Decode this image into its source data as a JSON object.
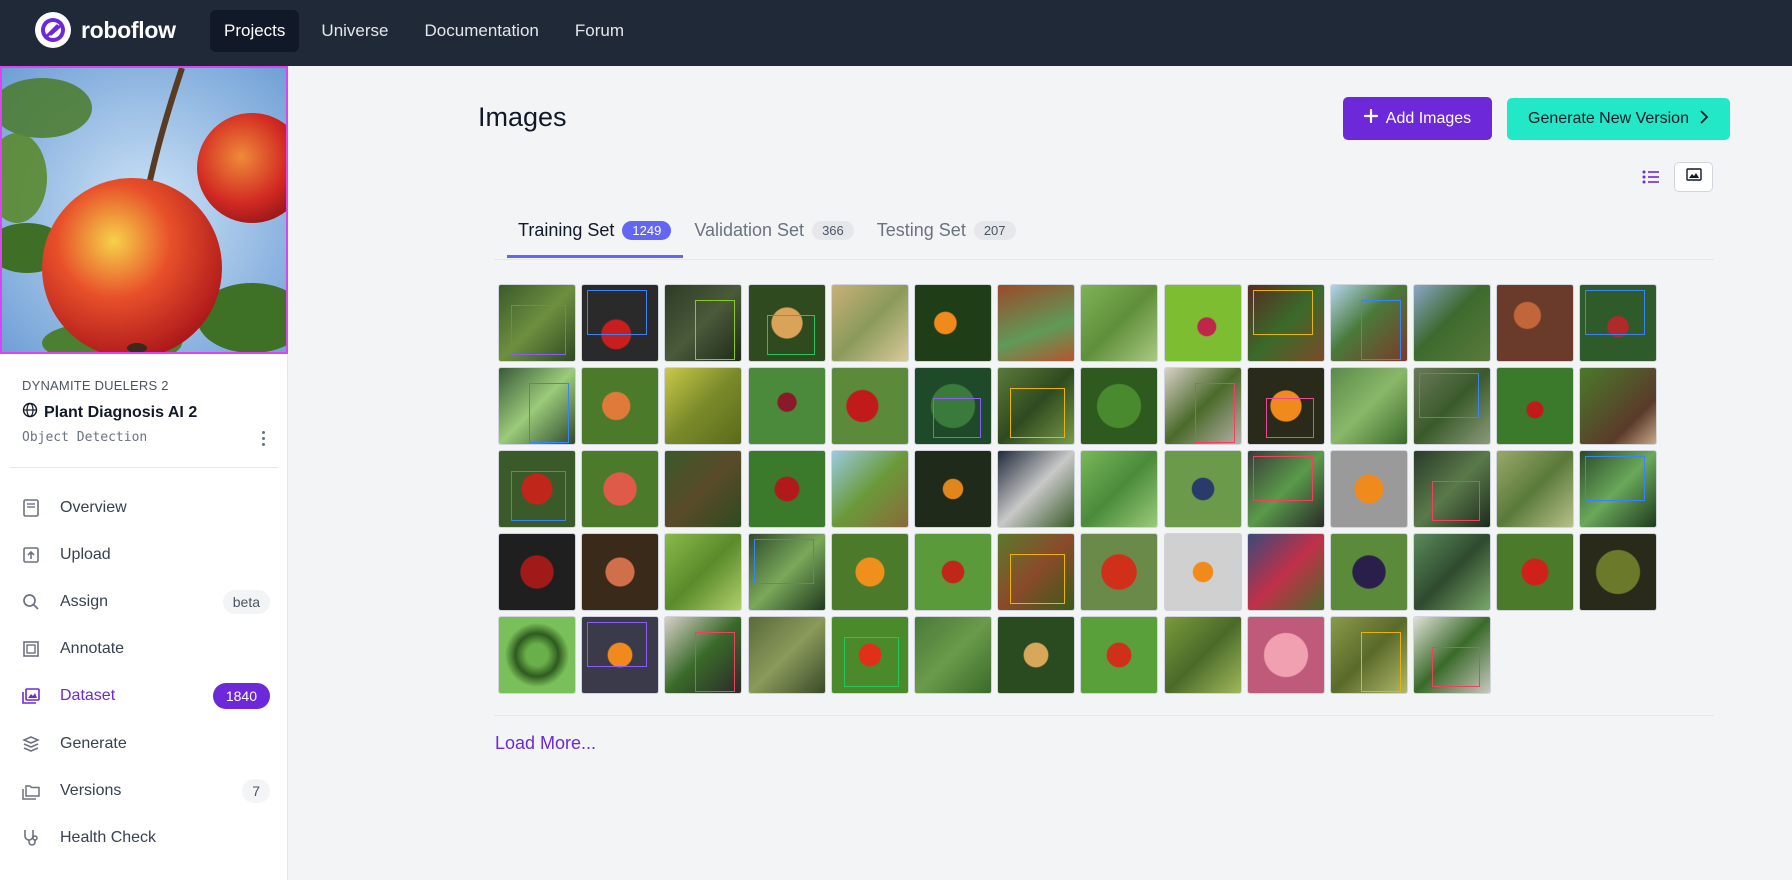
{
  "nav": {
    "brand": "roboflow",
    "links": [
      {
        "label": "Projects",
        "active": true
      },
      {
        "label": "Universe",
        "active": false
      },
      {
        "label": "Documentation",
        "active": false
      },
      {
        "label": "Forum",
        "active": false
      }
    ]
  },
  "sidebar": {
    "workspace": "DYNAMITE DUELERS 2",
    "project_name": "Plant Diagnosis AI 2",
    "project_type": "Object Detection",
    "items": [
      {
        "label": "Overview",
        "icon": "book-icon",
        "badge": ""
      },
      {
        "label": "Upload",
        "icon": "upload-icon",
        "badge": ""
      },
      {
        "label": "Assign",
        "icon": "search-icon",
        "badge": "beta"
      },
      {
        "label": "Annotate",
        "icon": "annotate-icon",
        "badge": ""
      },
      {
        "label": "Dataset",
        "icon": "images-icon",
        "badge": "1840",
        "active": true
      },
      {
        "label": "Generate",
        "icon": "generate-icon",
        "badge": ""
      },
      {
        "label": "Versions",
        "icon": "folders-icon",
        "badge": "7"
      },
      {
        "label": "Health Check",
        "icon": "stethoscope-icon",
        "badge": ""
      }
    ]
  },
  "main": {
    "title": "Images",
    "add_images_label": "Add Images",
    "generate_label": "Generate New Version",
    "tabs": [
      {
        "label": "Training Set",
        "count": "1249",
        "active": true
      },
      {
        "label": "Validation Set",
        "count": "366",
        "active": false
      },
      {
        "label": "Testing Set",
        "count": "207",
        "active": false
      }
    ],
    "load_more": "Load More..."
  },
  "colors": {
    "accent": "#6d28d9",
    "generate_button": "#22e8c8",
    "tab_active": "#6366f1",
    "nav_bg": "#1f2937"
  },
  "thumbnails": [
    {
      "bg": "linear-gradient(135deg,#3a5a2a,#6d8f3f 50%,#2f4a22)",
      "box": "#8b5cf6"
    },
    {
      "bg": "radial-gradient(circle at 45% 65%,#c81e1e 0 22%,#2a2a2a 24%)",
      "box": "#3b82f6"
    },
    {
      "bg": "linear-gradient(135deg,#2d3b26,#4a5a3a 50%,#1f2a1a)",
      "box": "#84cc16"
    },
    {
      "bg": "radial-gradient(circle at 50% 50%,#d9a35a 0 28%,#2f4a1f 30%)",
      "box": "#22c55e"
    },
    {
      "bg": "linear-gradient(135deg,#c8b079,#8a9a5a 50%,#d9c99a)",
      "box": ""
    },
    {
      "bg": "radial-gradient(circle at 40% 50%,#f08a1c 0 18%,#1f3d17 20%)",
      "box": ""
    },
    {
      "bg": "linear-gradient(160deg,#9a4a2a,#5f9a58 60%,#b3562f)",
      "box": ""
    },
    {
      "bg": "linear-gradient(135deg,#7fb357,#5f8f3a 50%,#a9c982)",
      "box": ""
    },
    {
      "bg": "radial-gradient(circle at 55% 55%,#c0264a 0 15%,#7cbd32 17%)",
      "box": ""
    },
    {
      "bg": "linear-gradient(135deg,#5a2a22,#3a6a2a 50%,#7a4a2a)",
      "box": "#eab308"
    },
    {
      "bg": "linear-gradient(135deg,#b3d4ef,#4a7a3a 45%,#7a3a2a)",
      "box": "#3b82f6"
    },
    {
      "bg": "linear-gradient(135deg,#8aa6c8,#3d6a2f 45%,#5a7a3a)",
      "box": ""
    },
    {
      "bg": "radial-gradient(circle at 40% 40%,#c0663a 0 20%,#6a3a2a 22%)",
      "box": ""
    },
    {
      "bg": "radial-gradient(circle at 50% 55%,#b02a2a 0 18%,#2f5a2a 20%)",
      "box": "#3b82f6"
    },
    {
      "bg": "linear-gradient(135deg,#3a5a3a,#9acb7a 50%,#2f4a2f)",
      "box": "#3b82f6"
    },
    {
      "bg": "radial-gradient(circle at 45% 50%,#e07a3a 0 24%,#4a7a2a 26%)",
      "box": ""
    },
    {
      "bg": "linear-gradient(135deg,#c9c94a,#7a8a2a 50%,#5a6a1a)",
      "box": ""
    },
    {
      "bg": "radial-gradient(circle at 50% 45%,#8a1a2a 0 16%,#4a8a3a 18%)",
      "box": ""
    },
    {
      "bg": "radial-gradient(circle at 40% 50%,#c01a1a 0 26%,#5a8a3a 28%)",
      "box": ""
    },
    {
      "bg": "radial-gradient(circle,#3a7a3a 0 40%,#1f4a2a 42%)",
      "box": "#8b5cf6"
    },
    {
      "bg": "linear-gradient(135deg,#5a7a3a,#2f4a1f 50%,#7a9a4a)",
      "box": "#eab308"
    },
    {
      "bg": "radial-gradient(circle at 50% 50%,#4a8a2f 0 40%,#2f5a1f 42%)",
      "box": ""
    },
    {
      "bg": "linear-gradient(135deg,#d9d0c8,#4a6a2a 50%,#b8b0a8)",
      "box": "#f43f5e"
    },
    {
      "bg": "radial-gradient(circle at 50% 50%,#f08a1c 0 28%,#2a2a1a 30%)",
      "box": "#ec4899"
    },
    {
      "bg": "linear-gradient(135deg,#5a8a4a,#8ab86a 50%,#3a6a2a)",
      "box": ""
    },
    {
      "bg": "linear-gradient(135deg,#6a7a5a,#3a5a2a 50%,#8a9a7a)",
      "box": "#3b82f6"
    },
    {
      "bg": "radial-gradient(circle at 50% 55%,#c01a1a 0 14%,#3a7a2a 16%)",
      "box": ""
    },
    {
      "bg": "linear-gradient(135deg,#4a7a2a,#5a3a2a 70%,#c8a888)",
      "box": ""
    },
    {
      "bg": "radial-gradient(circle at 50% 50%,#c0261a 0 28%,#3a5a2a 30%)",
      "box": "#3b82f6"
    },
    {
      "bg": "radial-gradient(circle at 50% 50%,#e05a4a 0 30%,#4a7a2a 32%)",
      "box": ""
    },
    {
      "bg": "linear-gradient(135deg,#3a5a2a,#5a4a2a 50%,#2f4a1f)",
      "box": ""
    },
    {
      "bg": "radial-gradient(circle at 50% 50%,#b01a1a 0 22%,#3a7a2a 24%)",
      "box": ""
    },
    {
      "bg": "linear-gradient(135deg,#9acbe0,#6a9a3a 50%,#8a6a3a)",
      "box": ""
    },
    {
      "bg": "radial-gradient(circle at 50% 50%,#e0861c 0 18%,#1f2a1a 20%)",
      "box": ""
    },
    {
      "bg": "linear-gradient(135deg,#1f2a3a,#c8c8c8 50%,#3a5a2a)",
      "box": ""
    },
    {
      "bg": "linear-gradient(135deg,#7ab85a,#4a8a3a 50%,#9acb7a)",
      "box": ""
    },
    {
      "bg": "radial-gradient(circle at 50% 50%,#2a3a6a 0 20%,#6a9a4a 22%)",
      "box": ""
    },
    {
      "bg": "linear-gradient(135deg,#3a3a3a,#5a9a4a 50%,#2a2a2a)",
      "box": "#f43f5e"
    },
    {
      "bg": "radial-gradient(circle at 50% 50%,#f08a1c 0 26%,#9a9a9a 28%)",
      "box": ""
    },
    {
      "bg": "linear-gradient(135deg,#2a3a2a,#5a7a4a 50%,#1f2a1f)",
      "box": "#f43f5e"
    },
    {
      "bg": "linear-gradient(135deg,#9aa86a,#5a7a3a 50%,#b8c08a)",
      "box": ""
    },
    {
      "bg": "linear-gradient(135deg,#2a4a2a,#6aa85a 50%,#1f3a1f)",
      "box": "#3b82f6"
    },
    {
      "bg": "radial-gradient(circle at 50% 50%,#a01a1a 0 30%,#1f1f1f 32%)",
      "box": ""
    },
    {
      "bg": "radial-gradient(circle at 50% 50%,#d0704a 0 26%,#3a2a1a 28%)",
      "box": ""
    },
    {
      "bg": "linear-gradient(135deg,#8aba4a,#5a8a2a 50%,#b0d06a)",
      "box": ""
    },
    {
      "bg": "linear-gradient(135deg,#2f4a2a,#7aa85a 50%,#1f3a1f)",
      "box": "#3b82f6"
    },
    {
      "bg": "radial-gradient(circle at 50% 50%,#f0901c 0 26%,#4a7a2a 28%)",
      "box": ""
    },
    {
      "bg": "radial-gradient(circle at 50% 50%,#c0261a 0 20%,#5a9a3a 22%)",
      "box": ""
    },
    {
      "bg": "linear-gradient(135deg,#5a7a2a,#8a4a2a 50%,#3a5a1a)",
      "box": "#eab308"
    },
    {
      "bg": "radial-gradient(circle at 50% 50%,#d0301a 0 32%,#6a8a4a 34%)",
      "box": ""
    },
    {
      "bg": "radial-gradient(circle at 50% 50%,#f08a1c 0 18%,#d0d0d0 20%)",
      "box": ""
    },
    {
      "bg": "linear-gradient(135deg,#3a4a7a,#c0304a 50%,#4a6a2a)",
      "box": ""
    },
    {
      "bg": "radial-gradient(circle at 50% 50%,#2a1f4a 0 30%,#5a8a3a 32%)",
      "box": ""
    },
    {
      "bg": "linear-gradient(135deg,#5a8a5a,#2f4a2f 50%,#7aa86a)",
      "box": ""
    },
    {
      "bg": "radial-gradient(circle at 50% 50%,#d0201a 0 24%,#4a7a2a 26%)",
      "box": ""
    },
    {
      "bg": "radial-gradient(circle at 50% 50%,#6a7a2a 0 40%,#2a2a1a 42%)",
      "box": ""
    },
    {
      "bg": "radial-gradient(circle,#6ab04a 0 20%,#2f5a1f 40%,#7ac05a 60%)",
      "box": ""
    },
    {
      "bg": "radial-gradient(circle at 50% 50%,#f08a1c 0 22%,#3a3a4a 24%)",
      "box": "#8b5cf6"
    },
    {
      "bg": "linear-gradient(135deg,#d8d0c8,#3a6a2a 50%,#2a2a2a)",
      "box": "#f43f5e"
    },
    {
      "bg": "linear-gradient(135deg,#5a6a3a,#8a9a5a 50%,#3a4a2a)",
      "box": ""
    },
    {
      "bg": "radial-gradient(circle at 50% 50%,#e0301a 0 20%,#4a8a2a 22%)",
      "box": "#22c55e"
    },
    {
      "bg": "linear-gradient(135deg,#4a7a3a,#6a9a4a 50%,#3a6a2a)",
      "box": ""
    },
    {
      "bg": "radial-gradient(circle at 50% 50%,#d8a85a 0 22%,#2a4a1f 24%)",
      "box": ""
    },
    {
      "bg": "radial-gradient(circle at 50% 50%,#d0301a 0 22%,#5aa03a 24%)",
      "box": ""
    },
    {
      "bg": "linear-gradient(135deg,#7a9a3a,#4a6a2a 50%,#a0b85a)",
      "box": ""
    },
    {
      "bg": "radial-gradient(circle at 50% 50%,#f0a0b0 0 40%,#c05a7a 42%)",
      "box": ""
    },
    {
      "bg": "linear-gradient(135deg,#8a9a4a,#5a6a2a 50%,#b0b86a)",
      "box": "#eab308"
    },
    {
      "bg": "linear-gradient(135deg,#e0e0d8,#3a6a2a 50%,#c8c8c0)",
      "box": "#f43f5e"
    }
  ]
}
